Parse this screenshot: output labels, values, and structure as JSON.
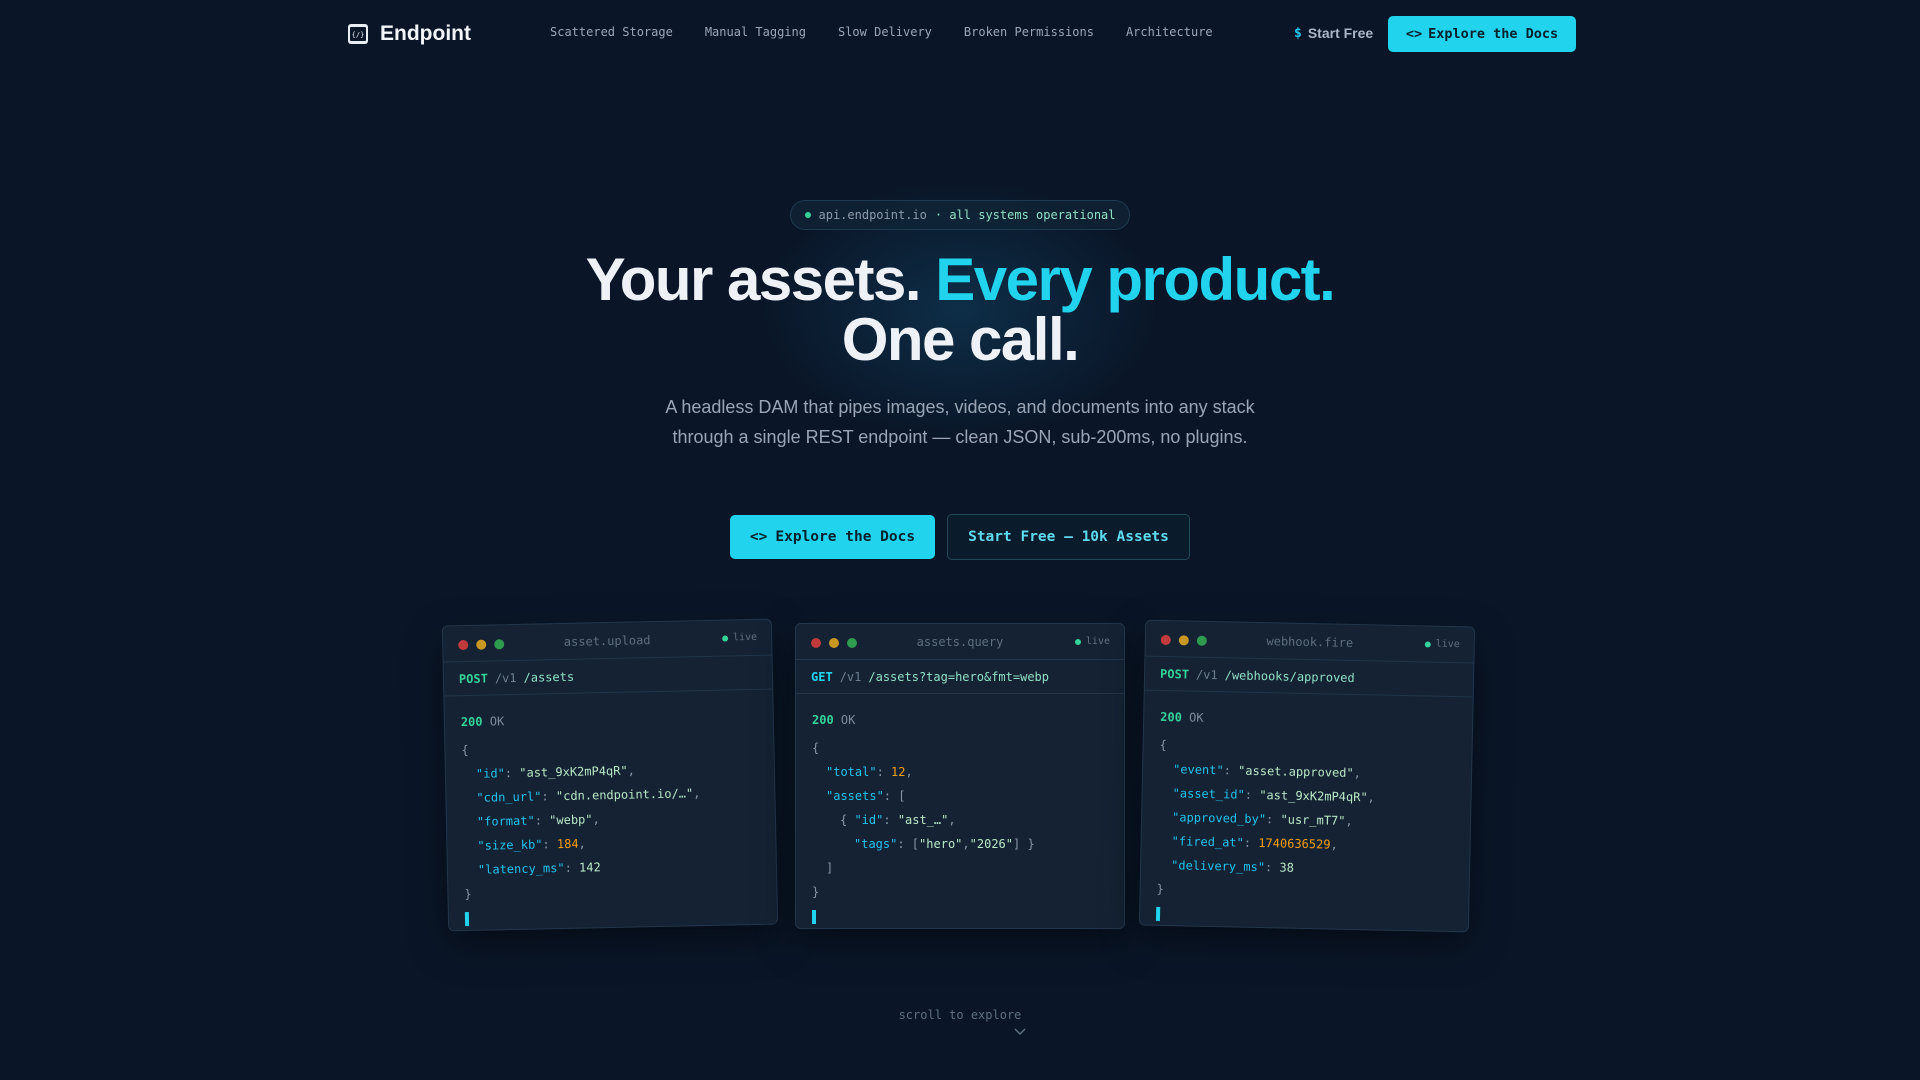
{
  "nav": {
    "brand": "Endpoint",
    "links": [
      "Scattered Storage",
      "Manual Tagging",
      "Slow Delivery",
      "Broken Permissions",
      "Architecture"
    ],
    "start_symbol": "$",
    "start_label": "Start Free",
    "cta_icon": "<>",
    "cta_label": "Explore the Docs"
  },
  "hero": {
    "pill_host": "api.endpoint.io",
    "pill_status": "· all systems operational",
    "title_part1": "Your assets. ",
    "title_accent": "Every product.",
    "title_part2": "One call.",
    "subtitle": "A headless DAM that pipes images, videos, and documents into any stack through a single REST endpoint — clean JSON, sub-200ms, no plugins.",
    "primary_icon": "<>",
    "primary_label": "Explore the Docs",
    "secondary_label": "Start Free — 10k Assets"
  },
  "cards": [
    {
      "title": "asset.upload",
      "live": "live",
      "method": "POST",
      "version": "/v1",
      "path": "/assets",
      "status_code": "200",
      "status_text": "OK",
      "fields": [
        {
          "key": "\"id\"",
          "value": "\"ast_9xK2mP4qR\"",
          "type": "s"
        },
        {
          "key": "\"cdn_url\"",
          "value": "\"cdn.endpoint.io/…\"",
          "type": "s"
        },
        {
          "key": "\"format\"",
          "value": "\"webp\"",
          "type": "s"
        },
        {
          "key": "\"size_kb\"",
          "value": "184",
          "type": "n"
        },
        {
          "key": "\"latency_ms\"",
          "value": "142",
          "type": "s"
        }
      ]
    },
    {
      "title": "assets.query",
      "live": "live",
      "method": "GET",
      "version": "/v1",
      "path": "/assets?tag=hero&fmt=webp",
      "status_code": "200",
      "status_text": "OK",
      "total_key": "\"total\"",
      "total_value": "12",
      "assets_key": "\"assets\"",
      "item_id_key": "\"id\"",
      "item_id_value": "\"ast_…\"",
      "tags_key": "\"tags\"",
      "tag1": "\"hero\"",
      "tag2": "\"2026\""
    },
    {
      "title": "webhook.fire",
      "live": "live",
      "method": "POST",
      "version": "/v1",
      "path": "/webhooks/approved",
      "status_code": "200",
      "status_text": "OK",
      "fields": [
        {
          "key": "\"event\"",
          "value": "\"asset.approved\"",
          "type": "s"
        },
        {
          "key": "\"asset_id\"",
          "value": "\"ast_9xK2mP4qR\"",
          "type": "s"
        },
        {
          "key": "\"approved_by\"",
          "value": "\"usr_mT7\"",
          "type": "s"
        },
        {
          "key": "\"fired_at\"",
          "value": "1740636529",
          "type": "n"
        },
        {
          "key": "\"delivery_ms\"",
          "value": "38",
          "type": "s"
        }
      ]
    }
  ],
  "scroll_hint": "scroll to explore",
  "colors": {
    "background": "#0a1628",
    "accent": "#22d3ee",
    "success": "#34d399",
    "number": "#f59e0b"
  }
}
